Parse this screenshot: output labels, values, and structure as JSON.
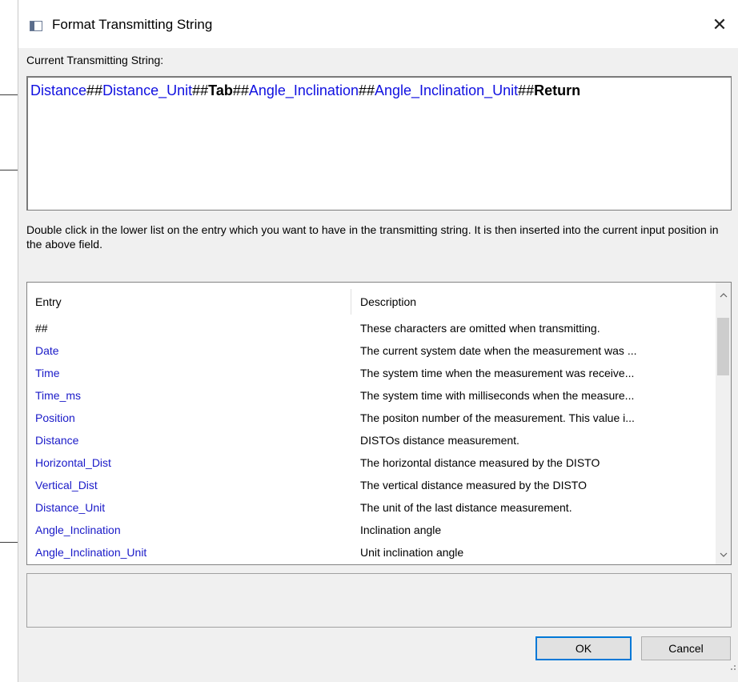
{
  "window": {
    "title": "Format Transmitting String",
    "close_glyph": "✕",
    "icon": "app-window-icon"
  },
  "current": {
    "label": "Current Transmitting String:",
    "tokens": [
      {
        "text": "Distance",
        "style": "field"
      },
      {
        "text": "##",
        "style": "sep"
      },
      {
        "text": "Distance_Unit",
        "style": "field"
      },
      {
        "text": "##",
        "style": "sep"
      },
      {
        "text": "Tab",
        "style": "bold"
      },
      {
        "text": "##",
        "style": "sep"
      },
      {
        "text": "Angle_Inclination",
        "style": "field"
      },
      {
        "text": "##",
        "style": "sep"
      },
      {
        "text": "Angle_Inclination_Unit",
        "style": "field"
      },
      {
        "text": "##",
        "style": "sep"
      },
      {
        "text": "Return",
        "style": "bold"
      }
    ]
  },
  "instructions": "Double click in the lower list on the entry which you want to have in the transmitting string. It is then inserted into the current input position in the above field.",
  "list": {
    "col_entry": "Entry",
    "col_description": "Description",
    "rows": [
      {
        "entry": "##",
        "description": "These characters are omitted when transmitting.",
        "color": "black"
      },
      {
        "entry": "Date",
        "description": "The current system date when the measurement was ...",
        "color": "blue"
      },
      {
        "entry": "Time",
        "description": "The system time when the measurement was receive...",
        "color": "blue"
      },
      {
        "entry": "Time_ms",
        "description": "The system time with milliseconds when the measure...",
        "color": "blue"
      },
      {
        "entry": "Position",
        "description": "The positon number of the measurement. This value i...",
        "color": "blue"
      },
      {
        "entry": "Distance",
        "description": "DISTOs distance measurement.",
        "color": "blue"
      },
      {
        "entry": "Horizontal_Dist",
        "description": "The horizontal distance measured  by the DISTO",
        "color": "blue"
      },
      {
        "entry": "Vertical_Dist",
        "description": "The vertical distance measured  by the DISTO",
        "color": "blue"
      },
      {
        "entry": "Distance_Unit",
        "description": "The unit of the last distance measurement.",
        "color": "blue"
      },
      {
        "entry": "Angle_Inclination",
        "description": "Inclination angle",
        "color": "blue"
      },
      {
        "entry": "Angle_Inclination_Unit",
        "description": "Unit inclination angle",
        "color": "blue"
      }
    ]
  },
  "buttons": {
    "ok": "OK",
    "cancel": "Cancel"
  },
  "scroll": {
    "up": "^",
    "down": "v"
  },
  "colors": {
    "field": "#1010e0",
    "accent": "#0078d7"
  }
}
